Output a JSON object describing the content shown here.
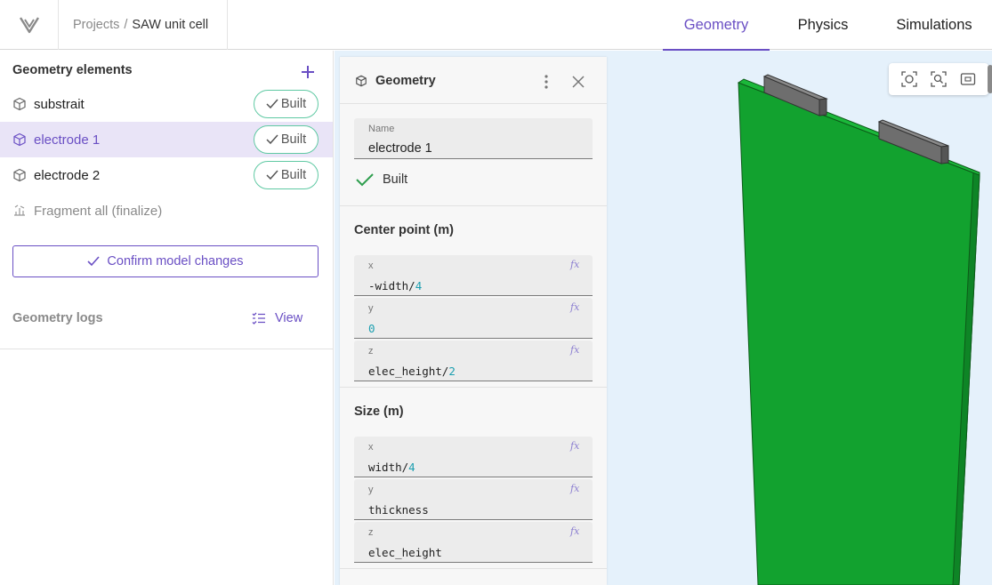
{
  "app": {
    "breadcrumb": {
      "root": "Projects",
      "separator": "/",
      "current": "SAW unit cell"
    },
    "tabs": [
      {
        "label": "Geometry",
        "active": true
      },
      {
        "label": "Physics",
        "active": false
      },
      {
        "label": "Simulations",
        "active": false
      }
    ],
    "accent_color": "#6a4fc4"
  },
  "sidebar": {
    "title": "Geometry elements",
    "add_icon": "plus-icon",
    "elements": [
      {
        "label": "substrait",
        "status": "Built",
        "icon": "cube-icon",
        "selected": false
      },
      {
        "label": "electrode 1",
        "status": "Built",
        "icon": "cube-icon",
        "selected": true
      },
      {
        "label": "electrode 2",
        "status": "Built",
        "icon": "cube-icon",
        "selected": false
      },
      {
        "label": "Fragment all (finalize)",
        "status": "",
        "icon": "fragment-icon",
        "selected": false
      }
    ],
    "confirm_label": "Confirm model changes",
    "logs_label": "Geometry logs",
    "view_label": "View"
  },
  "properties": {
    "title": "Geometry",
    "name_label": "Name",
    "name_value": "electrode 1",
    "status": "Built",
    "center": {
      "title": "Center point (m)",
      "fields": [
        {
          "label": "x",
          "expr": "-width/",
          "num": "4"
        },
        {
          "label": "y",
          "expr": "",
          "num": "0"
        },
        {
          "label": "z",
          "expr": "elec_height/",
          "num": "2"
        }
      ]
    },
    "size": {
      "title": "Size (m)",
      "fields": [
        {
          "label": "x",
          "expr": "width/",
          "num": "4"
        },
        {
          "label": "y",
          "expr": "thickness",
          "num": ""
        },
        {
          "label": "z",
          "expr": "elec_height",
          "num": ""
        }
      ]
    },
    "fx_symbol": "fx"
  },
  "viewport": {
    "background": "#e5f1fb",
    "substrate_color": "#12a22f",
    "electrode_color": "#6e6e6e",
    "tools": [
      "focus-icon",
      "zoom-fit-icon",
      "frame-icon"
    ]
  }
}
